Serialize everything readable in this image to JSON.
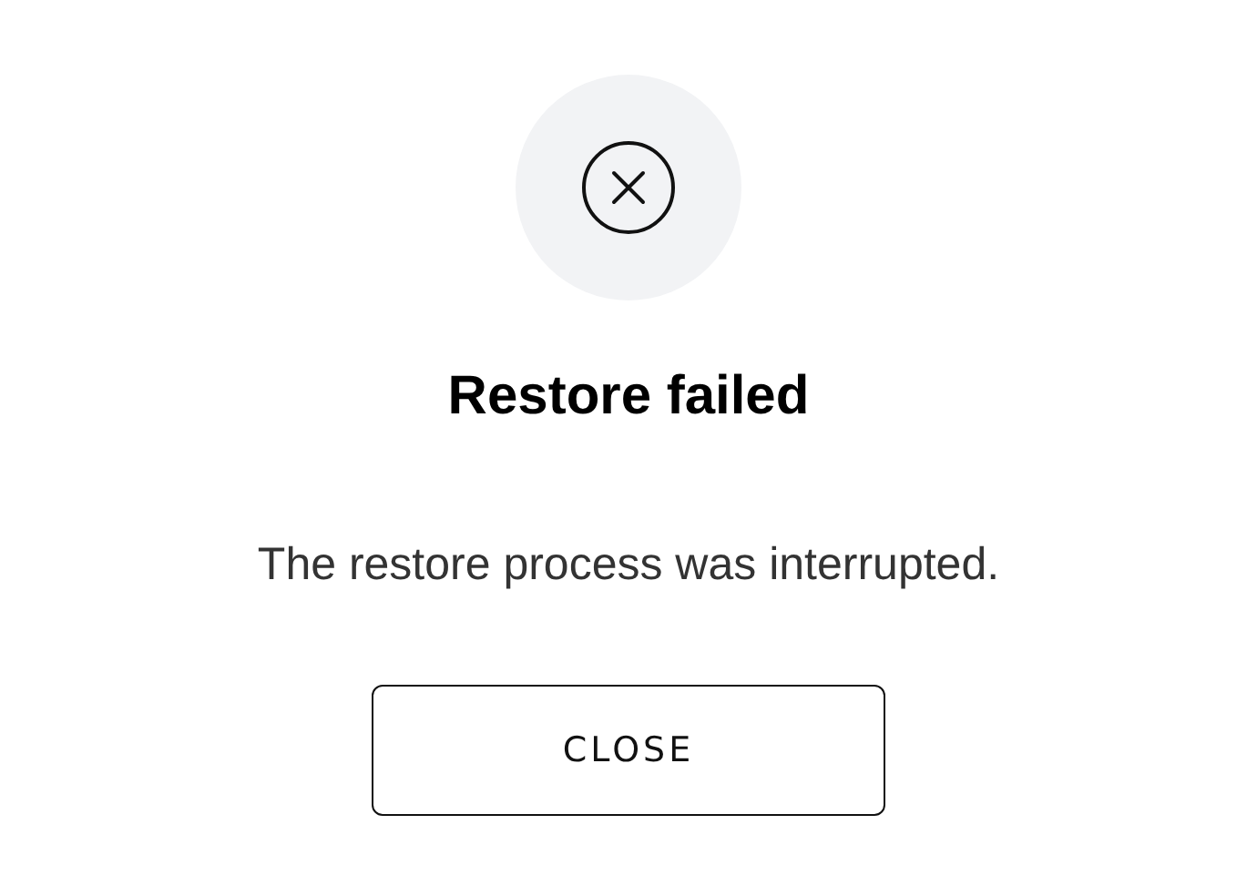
{
  "dialog": {
    "title": "Restore failed",
    "message": "The restore process was interrupted.",
    "button": "CLOSE"
  }
}
